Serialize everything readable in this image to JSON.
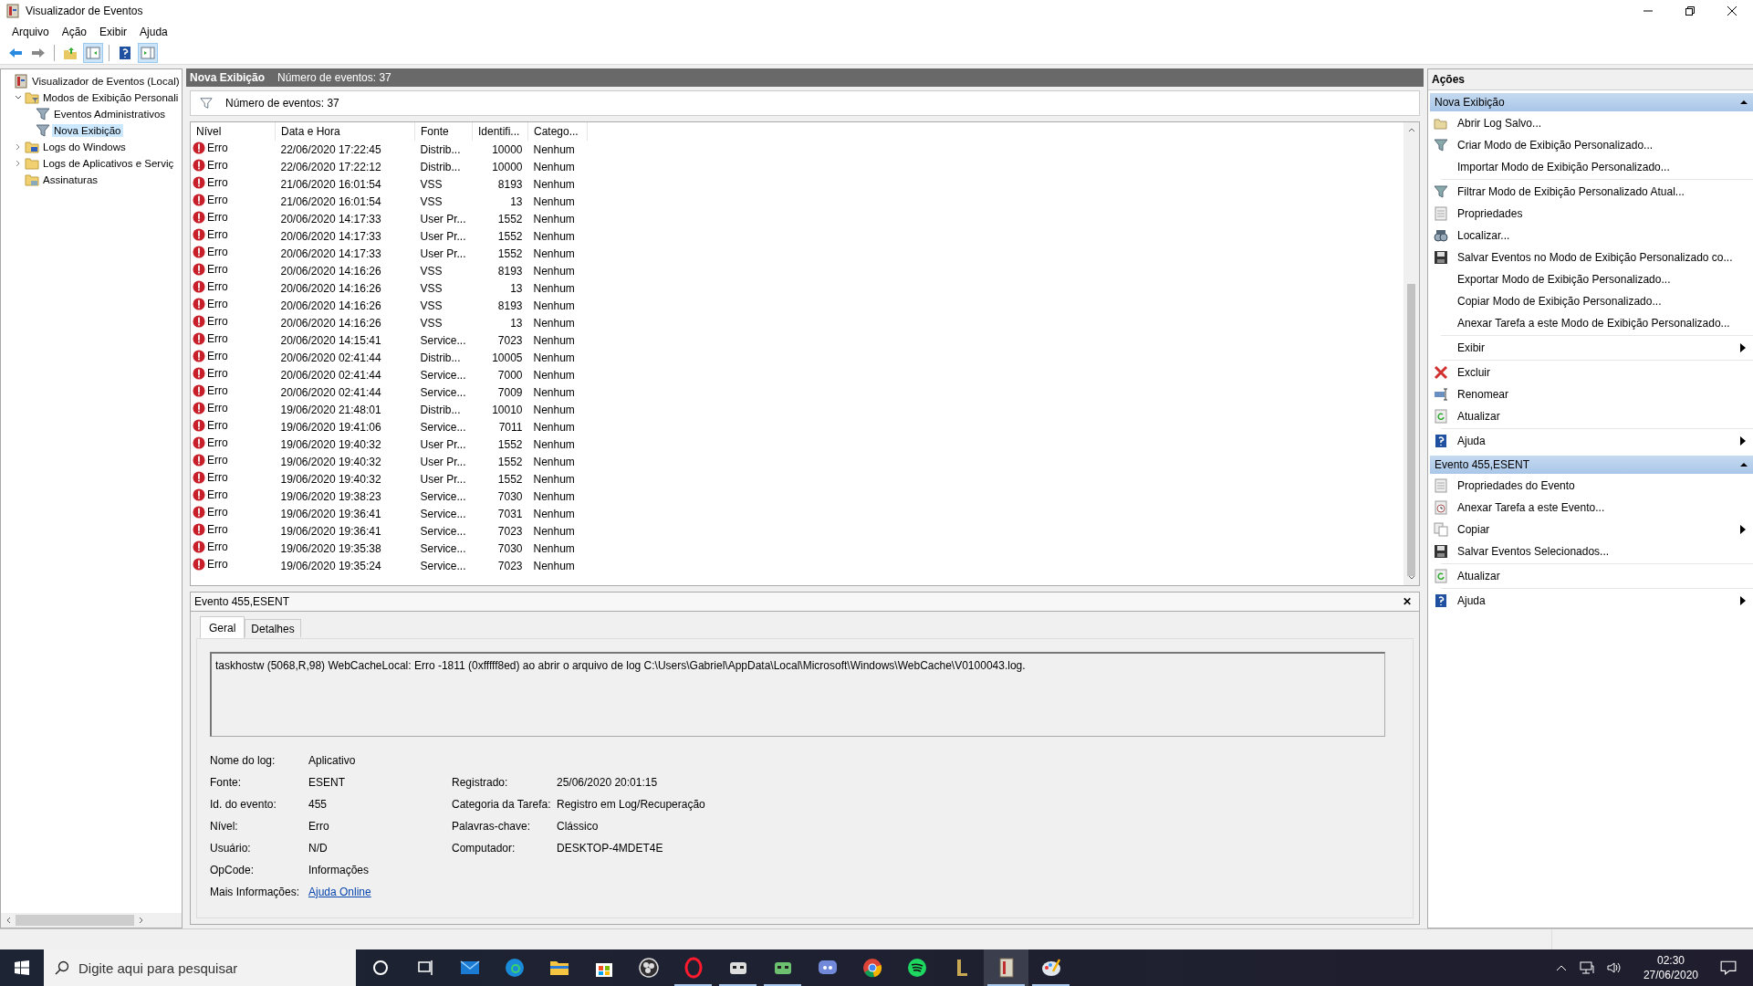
{
  "window": {
    "title": "Visualizador de Eventos"
  },
  "menu": [
    "Arquivo",
    "Ação",
    "Exibir",
    "Ajuda"
  ],
  "toolbar": [
    {
      "kind": "back",
      "pressed": false
    },
    {
      "kind": "forward",
      "pressed": false
    },
    {
      "kind": "up",
      "pressed": false
    },
    {
      "kind": "tree",
      "pressed": true
    },
    {
      "kind": "help",
      "pressed": false
    },
    {
      "kind": "actions",
      "pressed": true
    }
  ],
  "tree": [
    {
      "label": "Visualizador de Eventos (Local)",
      "kind": "viewer",
      "selected": false,
      "children": [
        {
          "label": "Modos de Exibição Personali",
          "kind": "folder-filter",
          "expanded": true,
          "selected": false,
          "children": [
            {
              "label": "Eventos Administrativos",
              "kind": "filter",
              "selected": false
            },
            {
              "label": "Nova Exibição",
              "kind": "filter",
              "selected": true
            }
          ]
        },
        {
          "label": "Logs do Windows",
          "kind": "folder-windows",
          "expanded": false,
          "selected": false
        },
        {
          "label": "Logs de Aplicativos e Serviç",
          "kind": "folder",
          "expanded": false,
          "selected": false
        },
        {
          "label": "Assinaturas",
          "kind": "folder-subs",
          "selected": false
        }
      ]
    }
  ],
  "view": {
    "title": "Nova Exibição",
    "count": "Número de eventos: 37",
    "filter_count": "Número de eventos: 37"
  },
  "table": {
    "columns": [
      "Nível",
      "Data e Hora",
      "Fonte",
      "Identifi...",
      "Catego..."
    ],
    "rows": [
      [
        "Erro",
        "22/06/2020 17:22:45",
        "Distrib...",
        "10000",
        "Nenhum"
      ],
      [
        "Erro",
        "22/06/2020 17:22:12",
        "Distrib...",
        "10000",
        "Nenhum"
      ],
      [
        "Erro",
        "21/06/2020 16:01:54",
        "VSS",
        "8193",
        "Nenhum"
      ],
      [
        "Erro",
        "21/06/2020 16:01:54",
        "VSS",
        "13",
        "Nenhum"
      ],
      [
        "Erro",
        "20/06/2020 14:17:33",
        "User Pr...",
        "1552",
        "Nenhum"
      ],
      [
        "Erro",
        "20/06/2020 14:17:33",
        "User Pr...",
        "1552",
        "Nenhum"
      ],
      [
        "Erro",
        "20/06/2020 14:17:33",
        "User Pr...",
        "1552",
        "Nenhum"
      ],
      [
        "Erro",
        "20/06/2020 14:16:26",
        "VSS",
        "8193",
        "Nenhum"
      ],
      [
        "Erro",
        "20/06/2020 14:16:26",
        "VSS",
        "13",
        "Nenhum"
      ],
      [
        "Erro",
        "20/06/2020 14:16:26",
        "VSS",
        "8193",
        "Nenhum"
      ],
      [
        "Erro",
        "20/06/2020 14:16:26",
        "VSS",
        "13",
        "Nenhum"
      ],
      [
        "Erro",
        "20/06/2020 14:15:41",
        "Service...",
        "7023",
        "Nenhum"
      ],
      [
        "Erro",
        "20/06/2020 02:41:44",
        "Distrib...",
        "10005",
        "Nenhum"
      ],
      [
        "Erro",
        "20/06/2020 02:41:44",
        "Service...",
        "7000",
        "Nenhum"
      ],
      [
        "Erro",
        "20/06/2020 02:41:44",
        "Service...",
        "7009",
        "Nenhum"
      ],
      [
        "Erro",
        "19/06/2020 21:48:01",
        "Distrib...",
        "10010",
        "Nenhum"
      ],
      [
        "Erro",
        "19/06/2020 19:41:06",
        "Service...",
        "7011",
        "Nenhum"
      ],
      [
        "Erro",
        "19/06/2020 19:40:32",
        "User Pr...",
        "1552",
        "Nenhum"
      ],
      [
        "Erro",
        "19/06/2020 19:40:32",
        "User Pr...",
        "1552",
        "Nenhum"
      ],
      [
        "Erro",
        "19/06/2020 19:40:32",
        "User Pr...",
        "1552",
        "Nenhum"
      ],
      [
        "Erro",
        "19/06/2020 19:38:23",
        "Service...",
        "7030",
        "Nenhum"
      ],
      [
        "Erro",
        "19/06/2020 19:36:41",
        "Service...",
        "7031",
        "Nenhum"
      ],
      [
        "Erro",
        "19/06/2020 19:36:41",
        "Service...",
        "7023",
        "Nenhum"
      ],
      [
        "Erro",
        "19/06/2020 19:35:38",
        "Service...",
        "7030",
        "Nenhum"
      ],
      [
        "Erro",
        "19/06/2020 19:35:24",
        "Service...",
        "7023",
        "Nenhum"
      ]
    ]
  },
  "details": {
    "title": "Evento 455,ESENT",
    "close": "✕",
    "tabs": [
      {
        "label": "Geral",
        "selected": true
      },
      {
        "label": "Detalhes",
        "selected": false
      }
    ],
    "message": "taskhostw (5068,R,98) WebCacheLocal: Erro -1811 (0xfffff8ed) ao abrir o arquivo de log C:\\Users\\Gabriel\\AppData\\Local\\Microsoft\\Windows\\WebCache\\V0100043.log.",
    "rows": [
      {
        "left": {
          "label": "Nome do log:",
          "value": "Aplicativo"
        }
      },
      {
        "left": {
          "label": "Fonte:",
          "value": "ESENT"
        },
        "right": {
          "label": "Registrado:",
          "value": "25/06/2020 20:01:15"
        }
      },
      {
        "left": {
          "label": "Id. do evento:",
          "value": "455"
        },
        "right": {
          "label": "Categoria da Tarefa:",
          "value": "Registro em Log/Recuperação"
        }
      },
      {
        "left": {
          "label": "Nível:",
          "value": "Erro"
        },
        "right": {
          "label": "Palavras-chave:",
          "value": "Clássico"
        }
      },
      {
        "left": {
          "label": "Usuário:",
          "value": "N/D"
        },
        "right": {
          "label": "Computador:",
          "value": "DESKTOP-4MDET4E"
        }
      },
      {
        "left": {
          "label": "OpCode:",
          "value": "Informações"
        }
      },
      {
        "left": {
          "label": "Mais Informações:",
          "link": "Ajuda Online"
        }
      }
    ]
  },
  "actions": {
    "title": "Ações",
    "sections": [
      {
        "title": "Nova Exibição",
        "groups": [
          [
            {
              "label": "Abrir Log Salvo...",
              "kind": "open",
              "submenu": false
            },
            {
              "label": "Criar Modo de Exibição Personalizado...",
              "kind": "filter",
              "submenu": false
            },
            {
              "label": "Importar Modo de Exibição Personalizado...",
              "kind": "plain",
              "submenu": false
            }
          ],
          [
            {
              "label": "Filtrar Modo de Exibição Personalizado Atual...",
              "kind": "filter",
              "submenu": false
            },
            {
              "label": "Propriedades",
              "kind": "properties",
              "submenu": false
            },
            {
              "label": "Localizar...",
              "kind": "find",
              "submenu": false
            },
            {
              "label": "Salvar Eventos no Modo de Exibição Personalizado co...",
              "kind": "save",
              "submenu": false
            },
            {
              "label": "Exportar Modo de Exibição Personalizado...",
              "kind": "plain",
              "submenu": false
            },
            {
              "label": "Copiar Modo de Exibição Personalizado...",
              "kind": "plain",
              "submenu": false
            },
            {
              "label": "Anexar Tarefa a este Modo de Exibição Personalizado...",
              "kind": "plain",
              "submenu": false
            }
          ],
          [
            {
              "label": "Exibir",
              "kind": "plain",
              "submenu": true
            }
          ],
          [
            {
              "label": "Excluir",
              "kind": "delete",
              "submenu": false
            },
            {
              "label": "Renomear",
              "kind": "rename",
              "submenu": false
            },
            {
              "label": "Atualizar",
              "kind": "refresh",
              "submenu": false
            }
          ],
          [
            {
              "label": "Ajuda",
              "kind": "help",
              "submenu": true
            }
          ]
        ]
      },
      {
        "title": "Evento 455,ESENT",
        "groups": [
          [
            {
              "label": "Propriedades do Evento",
              "kind": "properties",
              "submenu": false
            },
            {
              "label": "Anexar Tarefa a este Evento...",
              "kind": "task",
              "submenu": false
            },
            {
              "label": "Copiar",
              "kind": "copy",
              "submenu": true
            },
            {
              "label": "Salvar Eventos Selecionados...",
              "kind": "save",
              "submenu": false
            }
          ],
          [
            {
              "label": "Atualizar",
              "kind": "refresh",
              "submenu": false
            }
          ],
          [
            {
              "label": "Ajuda",
              "kind": "help",
              "submenu": true
            }
          ]
        ]
      }
    ]
  },
  "taskbar": {
    "search_placeholder": "Digite aqui para pesquisar",
    "apps": [
      {
        "kind": "ring",
        "running": false,
        "active": false
      },
      {
        "kind": "taskview",
        "running": false,
        "active": false
      },
      {
        "kind": "mail",
        "running": false,
        "active": false
      },
      {
        "kind": "swirl",
        "running": false,
        "active": false
      },
      {
        "kind": "folder",
        "running": false,
        "active": false
      },
      {
        "kind": "bag",
        "running": false,
        "active": false
      },
      {
        "kind": "aperture",
        "running": false,
        "active": false
      },
      {
        "kind": "oring",
        "running": true,
        "active": false
      },
      {
        "kind": "robot",
        "running": true,
        "active": false
      },
      {
        "kind": "robot2",
        "running": true,
        "active": false
      },
      {
        "kind": "chat",
        "running": false,
        "active": false
      },
      {
        "kind": "chrome",
        "running": false,
        "active": false
      },
      {
        "kind": "music",
        "running": false,
        "active": false
      },
      {
        "kind": "letter",
        "running": false,
        "active": false
      },
      {
        "kind": "viewer",
        "running": true,
        "active": true
      },
      {
        "kind": "palette",
        "running": true,
        "active": false
      }
    ],
    "time": "02:30",
    "date": "27/06/2020"
  }
}
